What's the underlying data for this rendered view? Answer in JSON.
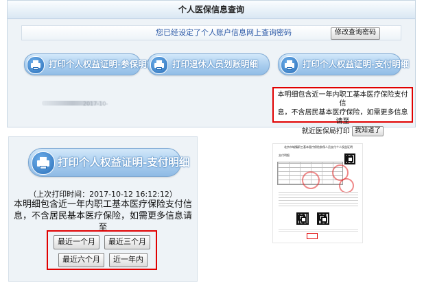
{
  "top_panel": {
    "title": "个人医保信息查询",
    "notice": "您已经设定了个人账户信息网上查询密码",
    "change_password_button": "修改查询密码",
    "print_buttons": [
      {
        "label": "打印个人权益证明-参保明细"
      },
      {
        "label": "打印退休人员划账明细"
      },
      {
        "label": "打印个人权益证明-支付明细"
      }
    ],
    "blurred_date": "2017-10-",
    "callout": {
      "line1": "本明细包含近一年内职工基本医疗保险支付信",
      "line2": "息，不含居民基本医疗保险，如需更多信息请至",
      "line3": "就近医保局打印",
      "ack_button": "我知道了"
    }
  },
  "zoom_panel": {
    "button_label": "打印个人权益证明-支付明细",
    "last_print": "（上次打印时间：2017-10-12 16:12:12）",
    "desc_line1": "本明细包含近一年内职工基本医疗保险支付信",
    "desc_line2": "息，不含居民基本医疗保险，如需更多信息请至",
    "desc_line3": "就近医保局打印",
    "ranges": [
      "最近一个月",
      "最近三个月",
      "最近六个月",
      "近一年内"
    ]
  },
  "document": {
    "title": "北京市城镇职工基本医疗保险参保人员支付个人权益证明",
    "subtitle": "支付明细"
  },
  "colors": {
    "accent": "#a9cdee",
    "highlight": "#e00000",
    "notice_text": "#2a58a6"
  }
}
